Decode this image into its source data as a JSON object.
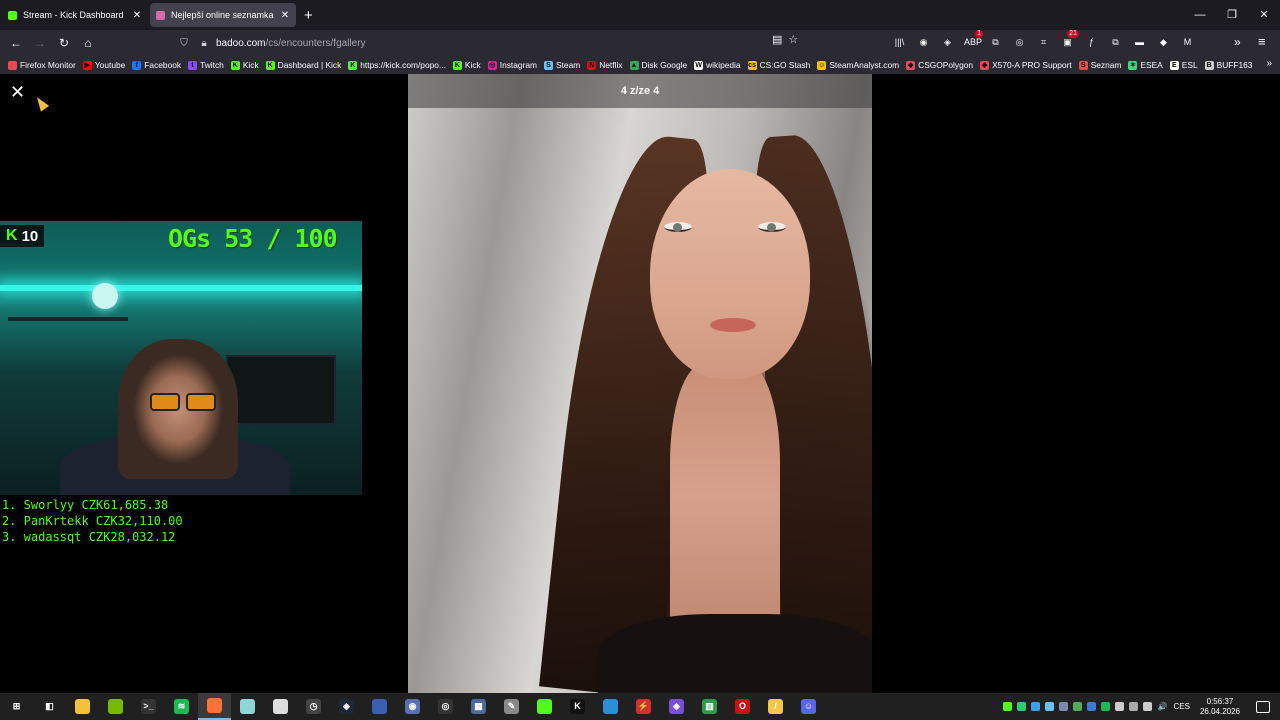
{
  "browser": {
    "tabs": [
      {
        "title": "Stream - Kick Dashboard",
        "close": "✕",
        "favicon_color": "#53fc18"
      },
      {
        "title": "Nejlepší online seznamka zdarma",
        "close": "✕",
        "favicon_color": "#d96aaa"
      }
    ],
    "new_tab": "+",
    "window_controls": {
      "minimize": "—",
      "restore": "❐",
      "close": "✕"
    },
    "nav": {
      "back": "←",
      "forward": "→",
      "reload": "↻",
      "home": "⌂"
    },
    "url": {
      "host": "badoo.com",
      "path": "/cs/encounters/fgallery"
    },
    "extensions": [
      {
        "name": "library-icon",
        "glyph": "|||\\"
      },
      {
        "name": "account-icon",
        "glyph": "◉"
      },
      {
        "name": "steam-ext-icon",
        "glyph": "◈"
      },
      {
        "name": "adblock-icon",
        "glyph": "ABP",
        "badge": "1"
      },
      {
        "name": "ext-icon-1",
        "glyph": "⧉"
      },
      {
        "name": "ext-icon-2",
        "glyph": "◎"
      },
      {
        "name": "puzzle-icon",
        "glyph": "⌗"
      },
      {
        "name": "ext-icon-3",
        "glyph": "▣",
        "badge": "21"
      },
      {
        "name": "ext-icon-4",
        "glyph": "ƒ"
      },
      {
        "name": "ext-icon-5",
        "glyph": "⧉"
      },
      {
        "name": "ext-icon-6",
        "glyph": "▬"
      },
      {
        "name": "ext-icon-7",
        "glyph": "◆"
      },
      {
        "name": "ext-icon-8",
        "glyph": "M"
      }
    ],
    "more": "»",
    "menu": "≡",
    "bookmarks": [
      {
        "label": "Firefox Monitor",
        "color": "#e24b52",
        "glyph": ""
      },
      {
        "label": "Youtube",
        "color": "#ff0000",
        "glyph": "▶"
      },
      {
        "label": "Facebook",
        "color": "#1877f2",
        "glyph": "f"
      },
      {
        "label": "Twitch",
        "color": "#9146ff",
        "glyph": "t"
      },
      {
        "label": "Kick",
        "color": "#53fc18",
        "glyph": "K"
      },
      {
        "label": "Dashboard | Kick",
        "color": "#53fc18",
        "glyph": "K"
      },
      {
        "label": "https://kick.com/popo...",
        "color": "#53fc18",
        "glyph": "K"
      },
      {
        "label": "Kick",
        "color": "#53fc18",
        "glyph": "K"
      },
      {
        "label": "Instagram",
        "color": "#d6249f",
        "glyph": "◎"
      },
      {
        "label": "Steam",
        "color": "#66c0f4",
        "glyph": "S"
      },
      {
        "label": "Netflix",
        "color": "#e50914",
        "glyph": "N"
      },
      {
        "label": "Disk Google",
        "color": "#34a853",
        "glyph": "▲"
      },
      {
        "label": "wikipedia",
        "color": "#ffffff",
        "glyph": "W"
      },
      {
        "label": "CS:GO Stash",
        "color": "#f2c200",
        "glyph": "cs"
      },
      {
        "label": "SteamAnalyst.com",
        "color": "#f2c200",
        "glyph": "☺"
      },
      {
        "label": "CSGOPolygon",
        "color": "#e24b52",
        "glyph": "◆"
      },
      {
        "label": "X570-A PRO Support",
        "color": "#e24b52",
        "glyph": "◈"
      },
      {
        "label": "Seznam",
        "color": "#e84d44",
        "glyph": "S"
      },
      {
        "label": "ESEA",
        "color": "#3fd87a",
        "glyph": "✶"
      },
      {
        "label": "ESL",
        "color": "#ffffff",
        "glyph": "E"
      },
      {
        "label": "BUFF163",
        "color": "#cccccc",
        "glyph": "B"
      }
    ],
    "bookmarks_more": "»"
  },
  "gallery": {
    "close": "✕",
    "counter": "4 z/ze 4"
  },
  "stream_overlay": {
    "kick_logo": "K",
    "viewers": "10",
    "og_count": "OGs 53 / 100",
    "leaderboard": [
      "1. Sworlyy CZK61,685.38",
      "2. PanKrtekk CZK32,110.00",
      "3. wadassqt CZK28,032.12"
    ]
  },
  "taskbar": {
    "apps": [
      {
        "name": "start-button-icon",
        "color": "#202020",
        "glyph": "⊞"
      },
      {
        "name": "widgets-icon",
        "color": "#202020",
        "glyph": "◧"
      },
      {
        "name": "file-explorer-icon",
        "color": "#f3c13a",
        "glyph": ""
      },
      {
        "name": "nvidia-icon",
        "color": "#76b900",
        "glyph": ""
      },
      {
        "name": "terminal-icon",
        "color": "#333333",
        "glyph": ">_"
      },
      {
        "name": "spotify-icon",
        "color": "#1db954",
        "glyph": "≋"
      },
      {
        "name": "firefox-icon",
        "color": "#ff7139",
        "glyph": ""
      },
      {
        "name": "app-icon-1",
        "color": "#8fd6d6",
        "glyph": ""
      },
      {
        "name": "app-icon-2",
        "color": "#dddddd",
        "glyph": ""
      },
      {
        "name": "clock-app-icon",
        "color": "#444444",
        "glyph": "◷"
      },
      {
        "name": "steam-icon",
        "color": "#1b2838",
        "glyph": "◈"
      },
      {
        "name": "app-icon-3",
        "color": "#3a5fb0",
        "glyph": ""
      },
      {
        "name": "app-icon-4",
        "color": "#5a6fb0",
        "glyph": "◉"
      },
      {
        "name": "obs-icon",
        "color": "#333333",
        "glyph": "◎"
      },
      {
        "name": "calculator-icon",
        "color": "#4a6a9a",
        "glyph": "▦"
      },
      {
        "name": "app-icon-5",
        "color": "#888888",
        "glyph": "✎"
      },
      {
        "name": "kick-green-icon",
        "color": "#53fc18",
        "glyph": ""
      },
      {
        "name": "kick-icon",
        "color": "#111111",
        "glyph": "K"
      },
      {
        "name": "app-icon-6",
        "color": "#2a8fd6",
        "glyph": ""
      },
      {
        "name": "app-icon-7",
        "color": "#d32f2f",
        "glyph": "⚡"
      },
      {
        "name": "app-icon-8",
        "color": "#7a4fd6",
        "glyph": "◈"
      },
      {
        "name": "app-icon-9",
        "color": "#2e9a4a",
        "glyph": "▥"
      },
      {
        "name": "opera-icon",
        "color": "#cc0f16",
        "glyph": "O"
      },
      {
        "name": "app-icon-10",
        "color": "#f2c94c",
        "glyph": "/"
      },
      {
        "name": "discord-icon",
        "color": "#5865f2",
        "glyph": "☺"
      }
    ],
    "tray_colors": [
      "#53fc18",
      "#2ecc71",
      "#3ba0e8",
      "#66c0f4",
      "#7a8ab0",
      "#55aa55",
      "#3a7bd5",
      "#1db954",
      "#cccccc",
      "#aaaaaa",
      "#cccccc"
    ],
    "volume": "🔊",
    "language": "CES",
    "time": "0:56:37",
    "date": "26.04.2026"
  }
}
